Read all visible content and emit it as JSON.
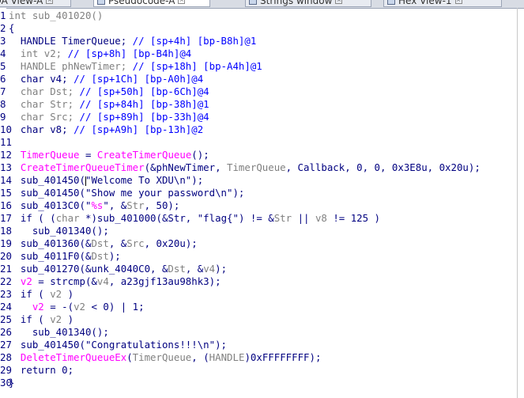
{
  "tabs": [
    {
      "label": "IDA View-A",
      "active": false,
      "icon": "ida-view-icon"
    },
    {
      "label": "Pseudocode-A",
      "active": true,
      "icon": "pseudocode-icon"
    },
    {
      "label": "Strings window",
      "active": false,
      "icon": "strings-icon"
    },
    {
      "label": "Hex View-1",
      "active": false,
      "icon": "hex-icon"
    }
  ],
  "colors": {
    "code_dark": "#000080",
    "comment": "#0000ff",
    "local_var": "#808080",
    "api_call": "#ff00ff",
    "string": "#008000"
  },
  "lines": [
    {
      "num": "1",
      "segments": [
        {
          "t": "int sub_401020()",
          "c": "tok-gray"
        }
      ]
    },
    {
      "num": "2",
      "segments": [
        {
          "t": "{",
          "c": "tok-dark"
        }
      ]
    },
    {
      "num": "3",
      "segments": [
        {
          "t": "  HANDLE TimerQueue; ",
          "c": "tok-dark"
        },
        {
          "t": "// [sp+4h] [bp-B8h]@1",
          "c": "tok-comment"
        }
      ]
    },
    {
      "num": "4",
      "segments": [
        {
          "t": "  int v2; ",
          "c": "tok-gray"
        },
        {
          "t": "// [sp+8h] [bp-B4h]@4",
          "c": "tok-comment"
        }
      ]
    },
    {
      "num": "5",
      "segments": [
        {
          "t": "  HANDLE phNewTimer; ",
          "c": "tok-gray"
        },
        {
          "t": "// [sp+18h] [bp-A4h]@1",
          "c": "tok-comment"
        }
      ]
    },
    {
      "num": "6",
      "segments": [
        {
          "t": "  char v4; ",
          "c": "tok-dark"
        },
        {
          "t": "// [sp+1Ch] [bp-A0h]@4",
          "c": "tok-comment"
        }
      ]
    },
    {
      "num": "7",
      "segments": [
        {
          "t": "  char Dst; ",
          "c": "tok-gray"
        },
        {
          "t": "// [sp+50h] [bp-6Ch]@4",
          "c": "tok-comment"
        }
      ]
    },
    {
      "num": "8",
      "segments": [
        {
          "t": "  char Str; ",
          "c": "tok-gray"
        },
        {
          "t": "// [sp+84h] [bp-38h]@1",
          "c": "tok-comment"
        }
      ]
    },
    {
      "num": "9",
      "segments": [
        {
          "t": "  char Src; ",
          "c": "tok-gray"
        },
        {
          "t": "// [sp+89h] [bp-33h]@4",
          "c": "tok-comment"
        }
      ]
    },
    {
      "num": "10",
      "segments": [
        {
          "t": "  char v8; ",
          "c": "tok-dark"
        },
        {
          "t": "// [sp+A9h] [bp-13h]@2",
          "c": "tok-comment"
        }
      ]
    },
    {
      "num": "11",
      "segments": [
        {
          "t": "",
          "c": "tok-dark"
        }
      ]
    },
    {
      "num": "12",
      "segments": [
        {
          "t": "  TimerQueue",
          "c": "tok-api"
        },
        {
          "t": " = ",
          "c": "tok-dark"
        },
        {
          "t": "CreateTimerQueue",
          "c": "tok-api"
        },
        {
          "t": "();",
          "c": "tok-dark"
        }
      ]
    },
    {
      "num": "13",
      "segments": [
        {
          "t": "  CreateTimerQueueTimer",
          "c": "tok-api"
        },
        {
          "t": "(&phNewTimer, ",
          "c": "tok-dark"
        },
        {
          "t": "TimerQueue",
          "c": "tok-gray"
        },
        {
          "t": ", Callback, 0, 0, 0x3E8u, 0x20u);",
          "c": "tok-dark"
        }
      ]
    },
    {
      "num": "14",
      "segments": [
        {
          "t": "  sub_401450(",
          "c": "tok-dark"
        },
        {
          "t": "\"Welcome To XDU\\n\"",
          "c": "tok-dark"
        },
        {
          "t": ");",
          "c": "tok-dark"
        }
      ],
      "caret_after": 0
    },
    {
      "num": "15",
      "segments": [
        {
          "t": "  sub_401450(\"Show me your password\\n\");",
          "c": "tok-dark"
        }
      ]
    },
    {
      "num": "16",
      "segments": [
        {
          "t": "  sub_4013C0(\"",
          "c": "tok-dark"
        },
        {
          "t": "%s",
          "c": "tok-api"
        },
        {
          "t": "\", &",
          "c": "tok-dark"
        },
        {
          "t": "Str",
          "c": "tok-gray"
        },
        {
          "t": ", 50);",
          "c": "tok-dark"
        }
      ]
    },
    {
      "num": "17",
      "segments": [
        {
          "t": "  if ( (",
          "c": "tok-dark"
        },
        {
          "t": "char",
          "c": "tok-gray"
        },
        {
          "t": " *)sub_401000(&Str, \"flag{\") != &",
          "c": "tok-dark"
        },
        {
          "t": "Str",
          "c": "tok-gray"
        },
        {
          "t": " || ",
          "c": "tok-dark"
        },
        {
          "t": "v8",
          "c": "tok-gray"
        },
        {
          "t": " != 125 )",
          "c": "tok-dark"
        }
      ]
    },
    {
      "num": "18",
      "segments": [
        {
          "t": "    sub_401340();",
          "c": "tok-dark"
        }
      ]
    },
    {
      "num": "19",
      "segments": [
        {
          "t": "  sub_401360(&",
          "c": "tok-dark"
        },
        {
          "t": "Dst",
          "c": "tok-gray"
        },
        {
          "t": ", &",
          "c": "tok-dark"
        },
        {
          "t": "Src",
          "c": "tok-gray"
        },
        {
          "t": ", 0x20u);",
          "c": "tok-dark"
        }
      ]
    },
    {
      "num": "20",
      "segments": [
        {
          "t": "  sub_4011F0(&",
          "c": "tok-dark"
        },
        {
          "t": "Dst",
          "c": "tok-gray"
        },
        {
          "t": ");",
          "c": "tok-dark"
        }
      ]
    },
    {
      "num": "21",
      "segments": [
        {
          "t": "  sub_401270(&unk_4040C0, &",
          "c": "tok-dark"
        },
        {
          "t": "Dst",
          "c": "tok-gray"
        },
        {
          "t": ", &",
          "c": "tok-dark"
        },
        {
          "t": "v4",
          "c": "tok-gray"
        },
        {
          "t": ");",
          "c": "tok-dark"
        }
      ]
    },
    {
      "num": "22",
      "segments": [
        {
          "t": "  v2",
          "c": "tok-api"
        },
        {
          "t": " = strcmp(&",
          "c": "tok-dark"
        },
        {
          "t": "v4",
          "c": "tok-gray"
        },
        {
          "t": ", a23gjf13au98hk3);",
          "c": "tok-dark"
        }
      ]
    },
    {
      "num": "23",
      "segments": [
        {
          "t": "  if ( ",
          "c": "tok-dark"
        },
        {
          "t": "v2",
          "c": "tok-gray"
        },
        {
          "t": " )",
          "c": "tok-dark"
        }
      ]
    },
    {
      "num": "24",
      "segments": [
        {
          "t": "    v2",
          "c": "tok-api"
        },
        {
          "t": " = -(",
          "c": "tok-dark"
        },
        {
          "t": "v2",
          "c": "tok-gray"
        },
        {
          "t": " < 0) | 1;",
          "c": "tok-dark"
        }
      ]
    },
    {
      "num": "25",
      "segments": [
        {
          "t": "  if ( ",
          "c": "tok-dark"
        },
        {
          "t": "v2",
          "c": "tok-gray"
        },
        {
          "t": " )",
          "c": "tok-dark"
        }
      ]
    },
    {
      "num": "26",
      "segments": [
        {
          "t": "    sub_401340();",
          "c": "tok-dark"
        }
      ]
    },
    {
      "num": "27",
      "segments": [
        {
          "t": "  sub_401450(\"Congratulations!!!\\n\");",
          "c": "tok-dark"
        }
      ]
    },
    {
      "num": "28",
      "segments": [
        {
          "t": "  DeleteTimerQueueEx",
          "c": "tok-api"
        },
        {
          "t": "(",
          "c": "tok-dark"
        },
        {
          "t": "TimerQueue",
          "c": "tok-gray"
        },
        {
          "t": ", (",
          "c": "tok-dark"
        },
        {
          "t": "HANDLE",
          "c": "tok-gray"
        },
        {
          "t": ")0xFFFFFFFF);",
          "c": "tok-dark"
        }
      ]
    },
    {
      "num": "29",
      "segments": [
        {
          "t": "  return 0;",
          "c": "tok-dark"
        }
      ]
    },
    {
      "num": "30",
      "segments": [
        {
          "t": "}",
          "c": "tok-dark"
        }
      ]
    }
  ]
}
